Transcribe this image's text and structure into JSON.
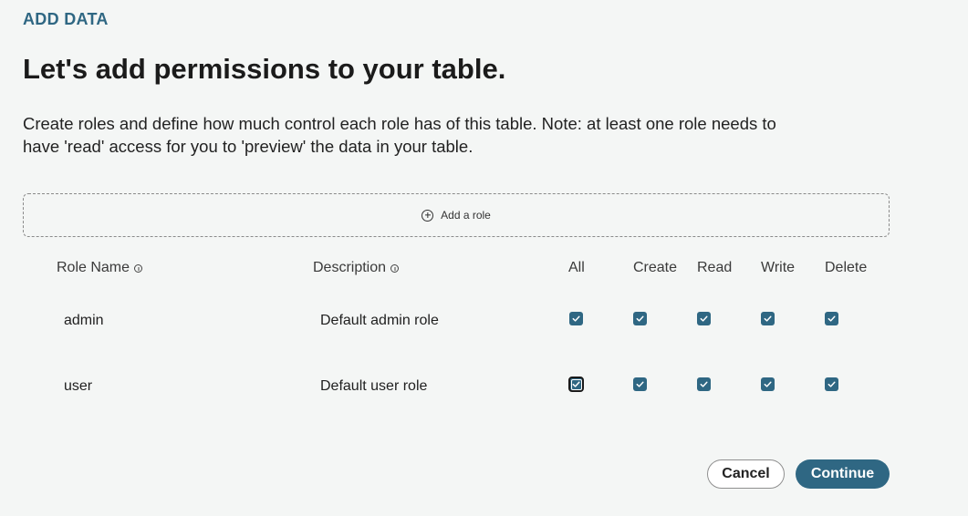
{
  "header": {
    "eyebrow": "ADD DATA",
    "title": "Let's add permissions to your table.",
    "description_line1": "Create roles and define how much control each role has of this table. Note: at least one role needs to",
    "description_line2": "have 'read' access for you to 'preview' the data in your table."
  },
  "add_role": {
    "label": "Add a role",
    "icon": "plus-circle-icon"
  },
  "table": {
    "columns": {
      "role_name": "Role Name",
      "description": "Description",
      "all": "All",
      "create": "Create",
      "read": "Read",
      "write": "Write",
      "delete": "Delete"
    },
    "rows": [
      {
        "name": "admin",
        "description": "Default admin role",
        "all": true,
        "create": true,
        "read": true,
        "write": true,
        "delete": true
      },
      {
        "name": "user",
        "description": "Default user role",
        "all": true,
        "create": true,
        "read": true,
        "write": true,
        "delete": true
      }
    ]
  },
  "footer": {
    "cancel_label": "Cancel",
    "continue_label": "Continue"
  },
  "colors": {
    "accent": "#2f6783",
    "background": "#f4f6f5"
  }
}
